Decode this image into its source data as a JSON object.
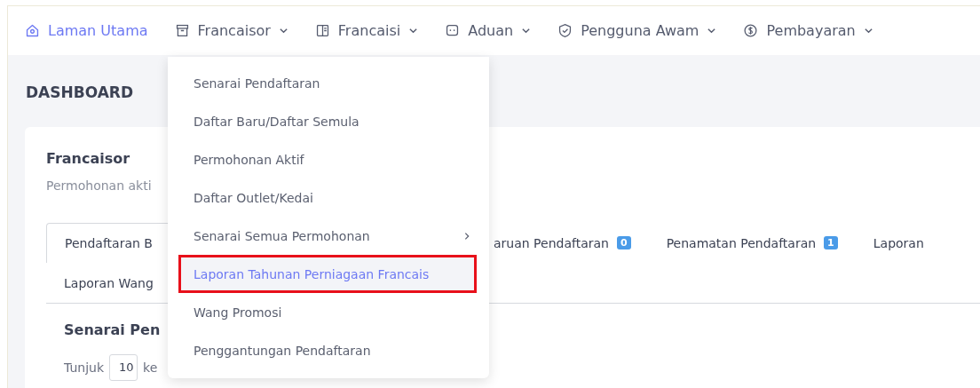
{
  "nav": [
    {
      "label": "Laman Utama",
      "selected": true,
      "dropdown": false
    },
    {
      "label": "Francaisor",
      "selected": false,
      "dropdown": true
    },
    {
      "label": "Francaisi",
      "selected": false,
      "dropdown": true
    },
    {
      "label": "Aduan",
      "selected": false,
      "dropdown": true
    },
    {
      "label": "Pengguna Awam",
      "selected": false,
      "dropdown": true
    },
    {
      "label": "Pembayaran",
      "selected": false,
      "dropdown": true
    }
  ],
  "page_title": "DASHBOARD",
  "card": {
    "title": "Francaisor",
    "subtitle": "Permohonan akti",
    "tab_rows": [
      [
        {
          "label": "Pendaftaran B",
          "selected": true
        },
        {
          "label": "aruan Pendaftaran",
          "badge": "0",
          "selected": false
        },
        {
          "label": "Penamatan Pendaftaran",
          "badge": "1",
          "selected": false
        },
        {
          "label": "Laporan",
          "selected": false
        }
      ],
      [
        {
          "label": "Laporan Wang",
          "selected": false
        }
      ]
    ],
    "section_title": "Senarai Pen",
    "show_label": "Tunjuk",
    "show_value": "10",
    "show_suffix": "ke"
  },
  "dropdown_menu": {
    "items": [
      {
        "label": "Senarai Pendaftaran",
        "kind": "link",
        "selected": false
      },
      {
        "label": "Daftar Baru/Daftar Semula",
        "kind": "link",
        "selected": false
      },
      {
        "label": "Permohonan Aktif",
        "kind": "link",
        "selected": false
      },
      {
        "label": "Daftar Outlet/Kedai",
        "kind": "link",
        "selected": false
      },
      {
        "label": "Senarai Semua Permohonan",
        "kind": "submenu",
        "selected": false
      },
      {
        "label": "Laporan Tahunan Perniagaan Francais",
        "kind": "link",
        "selected": true
      },
      {
        "label": "Wang Promosi",
        "kind": "link",
        "selected": false
      },
      {
        "label": "Penggantungan Pendaftaran",
        "kind": "link",
        "selected": false
      }
    ]
  }
}
